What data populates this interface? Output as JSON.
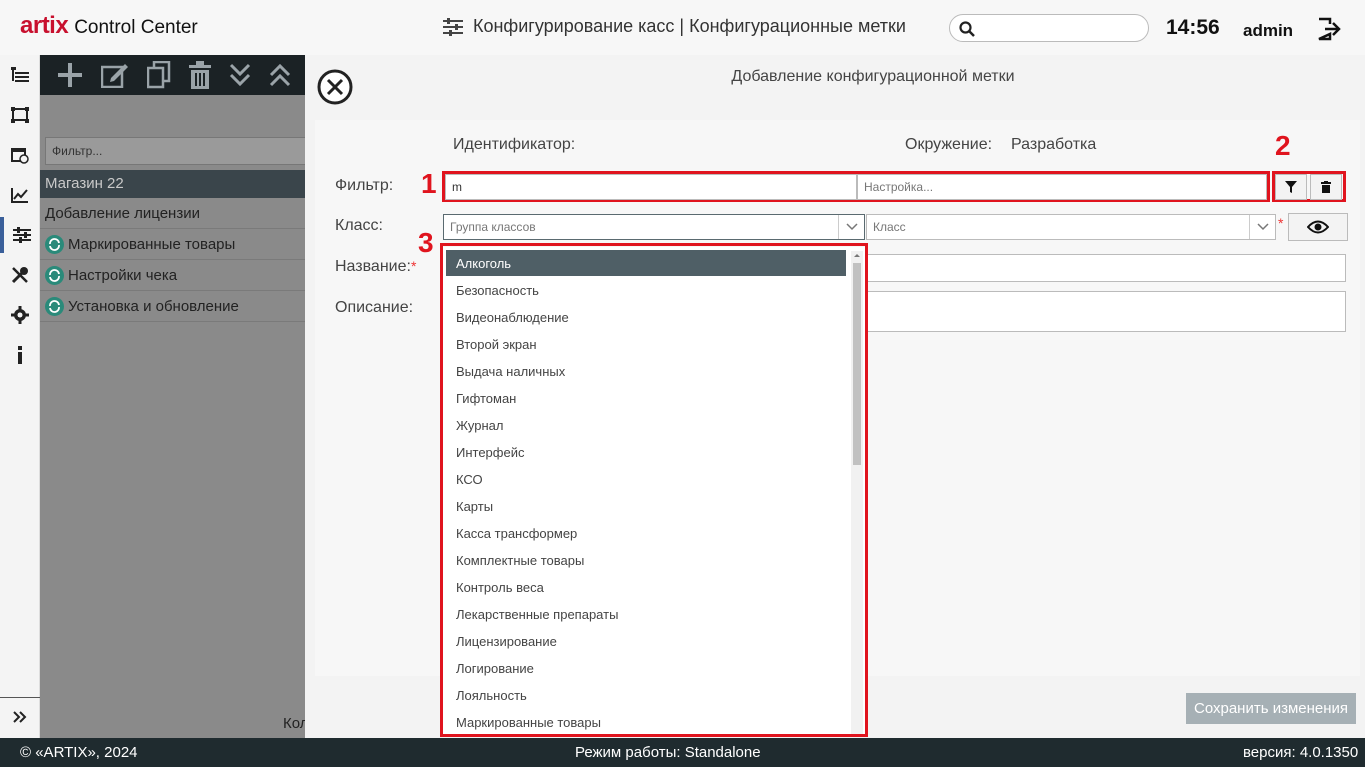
{
  "app": {
    "logo_text": "artix",
    "title": "Control Center"
  },
  "header": {
    "page_title": "Конфигурирование касс | Конфигурационные метки",
    "search_placeholder": "",
    "time": "14:56",
    "user": "admin"
  },
  "nav": {
    "icons": [
      "tree-icon",
      "screen-icon",
      "calendar-icon",
      "chart-icon",
      "sliders-icon",
      "tools-icon",
      "gear-icon",
      "info-icon"
    ],
    "active_index": 4
  },
  "middle": {
    "toolbar": [
      "add-icon",
      "edit-icon",
      "copy-icon",
      "delete-icon",
      "expand-all-icon",
      "collapse-all-icon"
    ],
    "filter_placeholder": "Фильтр...",
    "group": "Магазин 22",
    "rows": [
      {
        "label": "Добавление лицензии",
        "icon": false
      },
      {
        "label": "Маркированные товары",
        "icon": true
      },
      {
        "label": "Настройки чека",
        "icon": true
      },
      {
        "label": "Установка и обновление",
        "icon": true
      }
    ],
    "bottom_text": "Кол"
  },
  "modal": {
    "title": "Добавление конфигурационной метки",
    "identifier_label": "Идентификатор:",
    "environment_label": "Окружение:",
    "environment_value": "Разработка",
    "filter_label": "Фильтр:",
    "filter_value": "m",
    "filter_placeholder": "Настройка...",
    "class_label": "Класс:",
    "class_group_placeholder": "Группа классов",
    "class_placeholder": "Класс",
    "name_label": "Название:",
    "description_label": "Описание:",
    "required_mark": "*",
    "save_label": "Сохранить изменения",
    "annotations": [
      "1",
      "2",
      "3"
    ]
  },
  "dropdown": {
    "selected_index": 0,
    "items": [
      "Алкоголь",
      "Безопасность",
      "Видеонаблюдение",
      "Второй экран",
      "Выдача наличных",
      "Гифтоман",
      "Журнал",
      "Интерфейс",
      "КСО",
      "Карты",
      "Касса трансформер",
      "Комплектные товары",
      "Контроль веса",
      "Лекарственные препараты",
      "Лицензирование",
      "Логирование",
      "Лояльность",
      "Маркированные товары"
    ]
  },
  "footer": {
    "copyright": "© «ARTIX», 2024",
    "mode": "Режим работы: Standalone",
    "version": "версия: 4.0.1350"
  },
  "colors": {
    "accent_red": "#e0141e",
    "brand_red": "#c8102e",
    "dark": "#1f2b2f",
    "selected": "#4f5f66"
  }
}
